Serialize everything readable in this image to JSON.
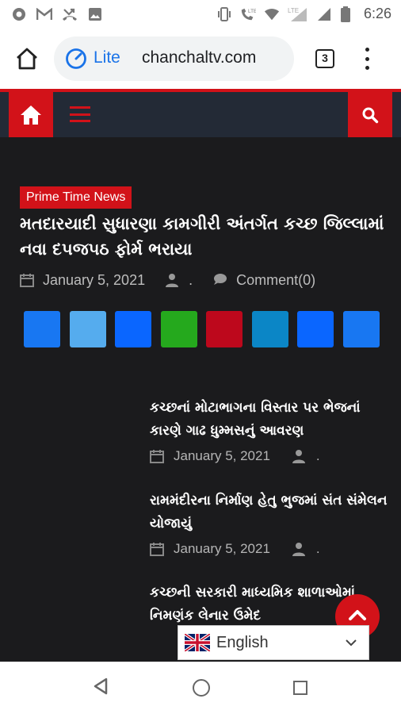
{
  "status_bar": {
    "time": "6:26",
    "left_icons": [
      "chrome-app-icon",
      "gmail-icon",
      "missed-call-icon",
      "gallery-icon"
    ],
    "right_icons": [
      "vibrate-icon",
      "lte-call-icon",
      "wifi-icon",
      "signal-lte-icon",
      "signal-icon",
      "battery-icon"
    ],
    "lte_label": "LTE"
  },
  "browser": {
    "mode_label": "Lite",
    "url": "chanchaltv.com",
    "tab_count": "3"
  },
  "site": {
    "featured": {
      "category": "Prime Time News",
      "title": "મતદારયાદી સુધારણા કામગીરી અંતર્ગત કચ્છ જિલ્લામાં નવા દ૫જ૫ઠ ફોર્મ ભરાયા",
      "date": "January 5, 2021",
      "author": ".",
      "comments": "Comment(0)"
    },
    "share_colors": [
      "#1877f2",
      "#55acee",
      "#0a66ff",
      "#25a91d",
      "#bd081c",
      "#0b86c6",
      "#0a66ff",
      "#1877f2"
    ],
    "share_icons": [
      "facebook-share-icon",
      "twitter-share-icon",
      "messenger-share-icon",
      "whatsapp-share-icon",
      "pinterest-share-icon",
      "linkedin-share-icon",
      "telegram-share-icon",
      "email-share-icon"
    ],
    "posts": [
      {
        "title": "કચ્છનાં મોટાભાગના વિસ્તાર પર ભેજનાં કારણે ગાઢ ધુમ્મસનું આવરણ",
        "date": "January 5, 2021",
        "author": "."
      },
      {
        "title": "રામમંદીરના નિર્માણ હેતુ ભુજમાં સંત સંમેલન યોજાયું",
        "date": "January 5, 2021",
        "author": "."
      },
      {
        "title": "કચ્છની સરકારી માધ્યમિક શાળાઓમાં નિમણંક લેનાર ઉમેદ",
        "date": "",
        "author": ""
      }
    ],
    "language": "English"
  },
  "colors": {
    "accent": "#d21219",
    "nav_bg": "#232a36",
    "page_bg": "#1b1b1d"
  }
}
